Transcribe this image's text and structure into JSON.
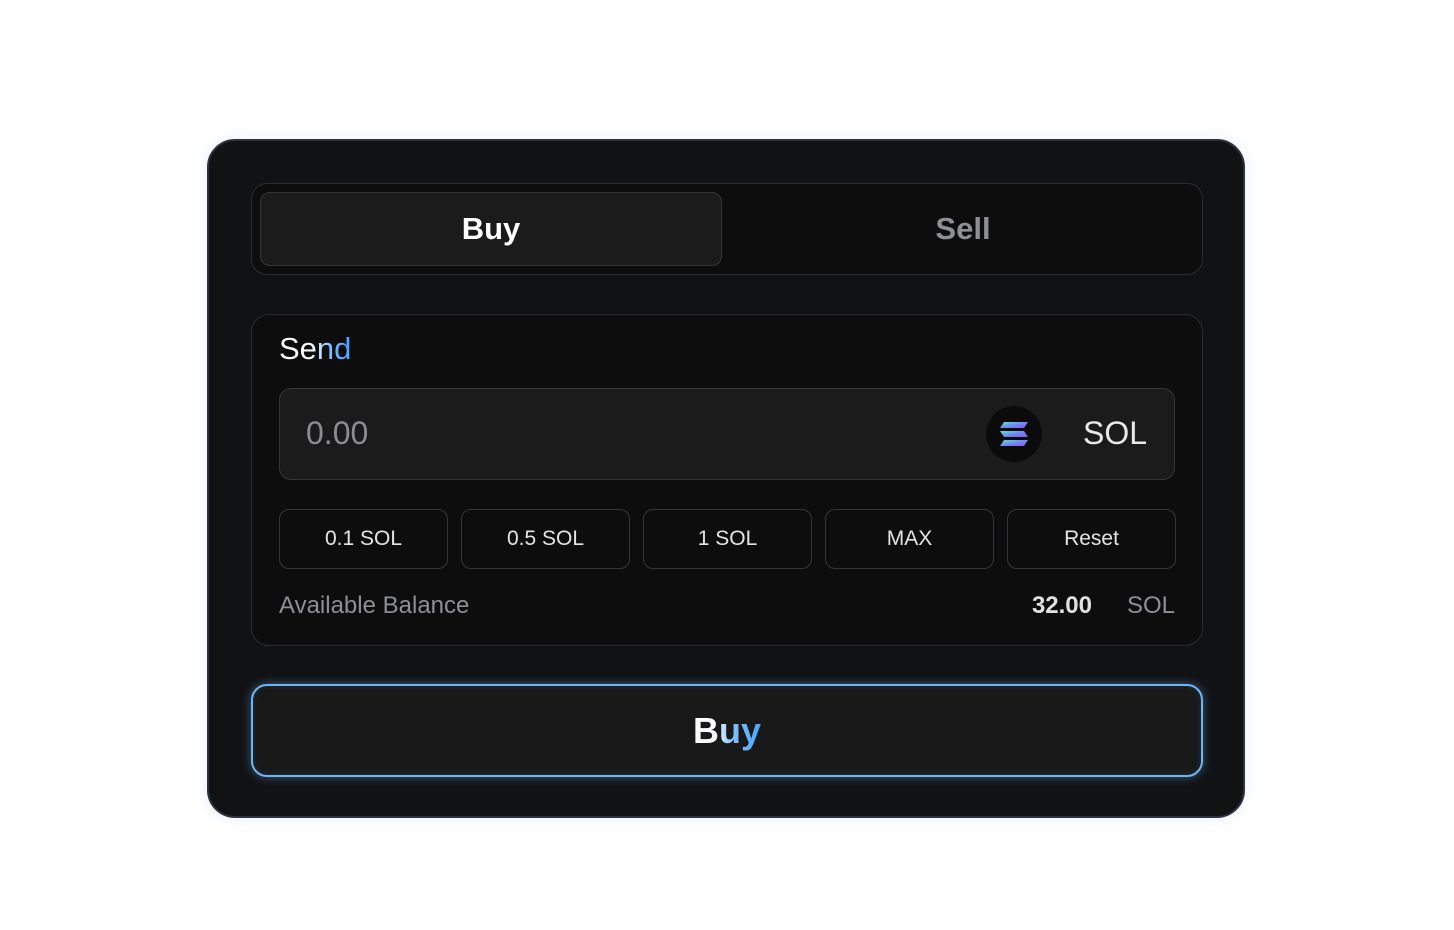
{
  "tabs": {
    "buy_label": "Buy",
    "sell_label": "Sell",
    "active": "buy"
  },
  "send": {
    "label": "Send",
    "amount_placeholder": "0.00",
    "amount_value": "",
    "token_icon": "solana-icon",
    "token_unit": "SOL"
  },
  "quick_amounts": [
    {
      "label": "0.1 SOL"
    },
    {
      "label": "0.5 SOL"
    },
    {
      "label": "1 SOL"
    },
    {
      "label": "MAX"
    },
    {
      "label": "Reset"
    }
  ],
  "balance": {
    "label": "Available Balance",
    "value": "32.00",
    "unit": "SOL"
  },
  "submit": {
    "label": "Buy"
  },
  "colors": {
    "card_bg": "#111214",
    "panel_bg": "#0d0d0e",
    "field_bg": "#1b1b1c",
    "accent": "#6db6f5",
    "muted_text": "#8d8f94"
  }
}
